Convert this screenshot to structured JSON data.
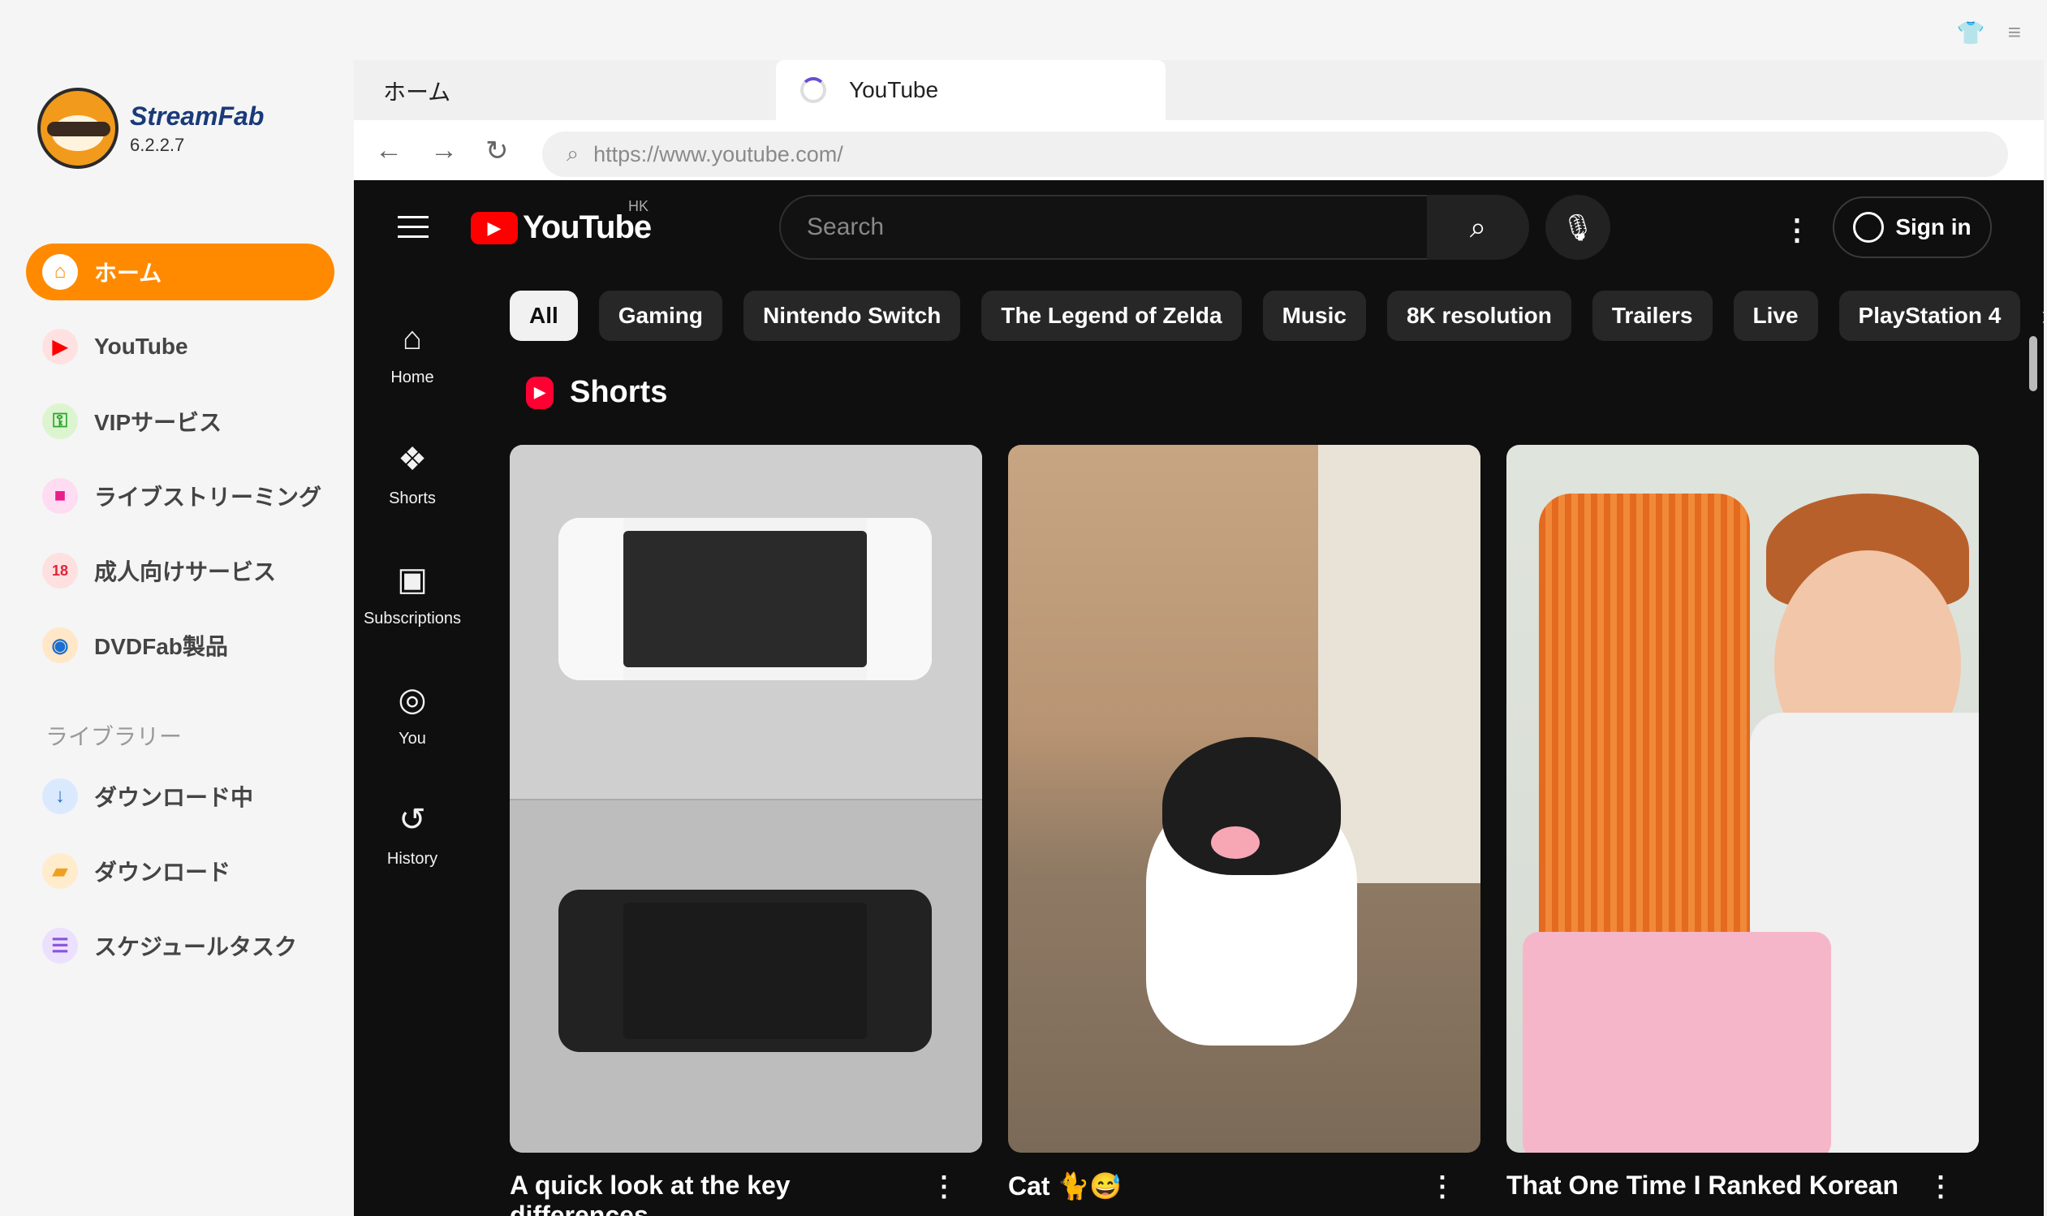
{
  "app": {
    "brand": "StreamFab",
    "version": "6.2.2.7"
  },
  "sidebar": {
    "items": [
      {
        "label": "ホーム",
        "icon": "home-icon",
        "active": true
      },
      {
        "label": "YouTube",
        "icon": "youtube-icon"
      },
      {
        "label": "VIPサービス",
        "icon": "key-icon"
      },
      {
        "label": "ライブストリーミング",
        "icon": "camera-icon"
      },
      {
        "label": "成人向けサービス",
        "icon": "adult-icon"
      },
      {
        "label": "DVDFab製品",
        "icon": "dvdfab-icon"
      }
    ],
    "library_label": "ライブラリー",
    "library": [
      {
        "label": "ダウンロード中",
        "icon": "download-arrow-icon"
      },
      {
        "label": "ダウンロード",
        "icon": "folder-icon"
      },
      {
        "label": "スケジュールタスク",
        "icon": "schedule-icon"
      }
    ]
  },
  "tabs": {
    "home": "ホーム",
    "youtube": "YouTube"
  },
  "browser": {
    "url": "https://www.youtube.com/"
  },
  "youtube": {
    "logo": "YouTube",
    "region": "HK",
    "search_placeholder": "Search",
    "sign_in": "Sign in",
    "nav": [
      {
        "label": "Home",
        "icon": "home-icon"
      },
      {
        "label": "Shorts",
        "icon": "shorts-icon"
      },
      {
        "label": "Subscriptions",
        "icon": "subscriptions-icon"
      },
      {
        "label": "You",
        "icon": "user-icon"
      },
      {
        "label": "History",
        "icon": "history-icon"
      }
    ],
    "chips": [
      "All",
      "Gaming",
      "Nintendo Switch",
      "The Legend of Zelda",
      "Music",
      "8K resolution",
      "Trailers",
      "Live",
      "PlayStation 4"
    ],
    "shorts_title": "Shorts",
    "shorts": [
      {
        "title": "A quick look at the key differences"
      },
      {
        "title": "Cat 🐈😅"
      },
      {
        "title": "That One Time I Ranked Korean"
      }
    ]
  },
  "colors": {
    "accent": "#ff8a00",
    "youtube_red": "#ff0000",
    "dark_bg": "#0f0f0f"
  }
}
